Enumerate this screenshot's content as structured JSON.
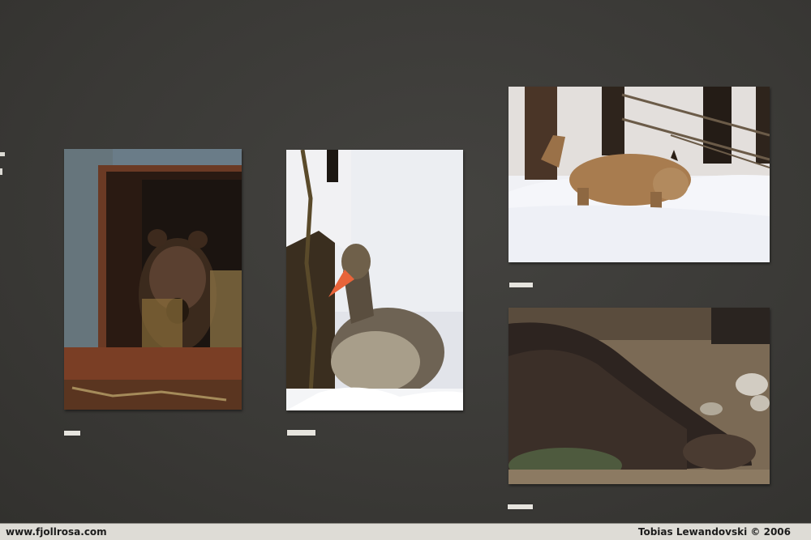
{
  "footer": {
    "website": "www.fjollrosa.com",
    "credit": "Tobias Lewandovski © 2006"
  },
  "photos": [
    {
      "subject": "brown bear in hay-filled window"
    },
    {
      "subject": "greylag goose sitting in snow"
    },
    {
      "subject": "lynx walking through snow"
    },
    {
      "subject": "wild boar resting on ground"
    }
  ]
}
